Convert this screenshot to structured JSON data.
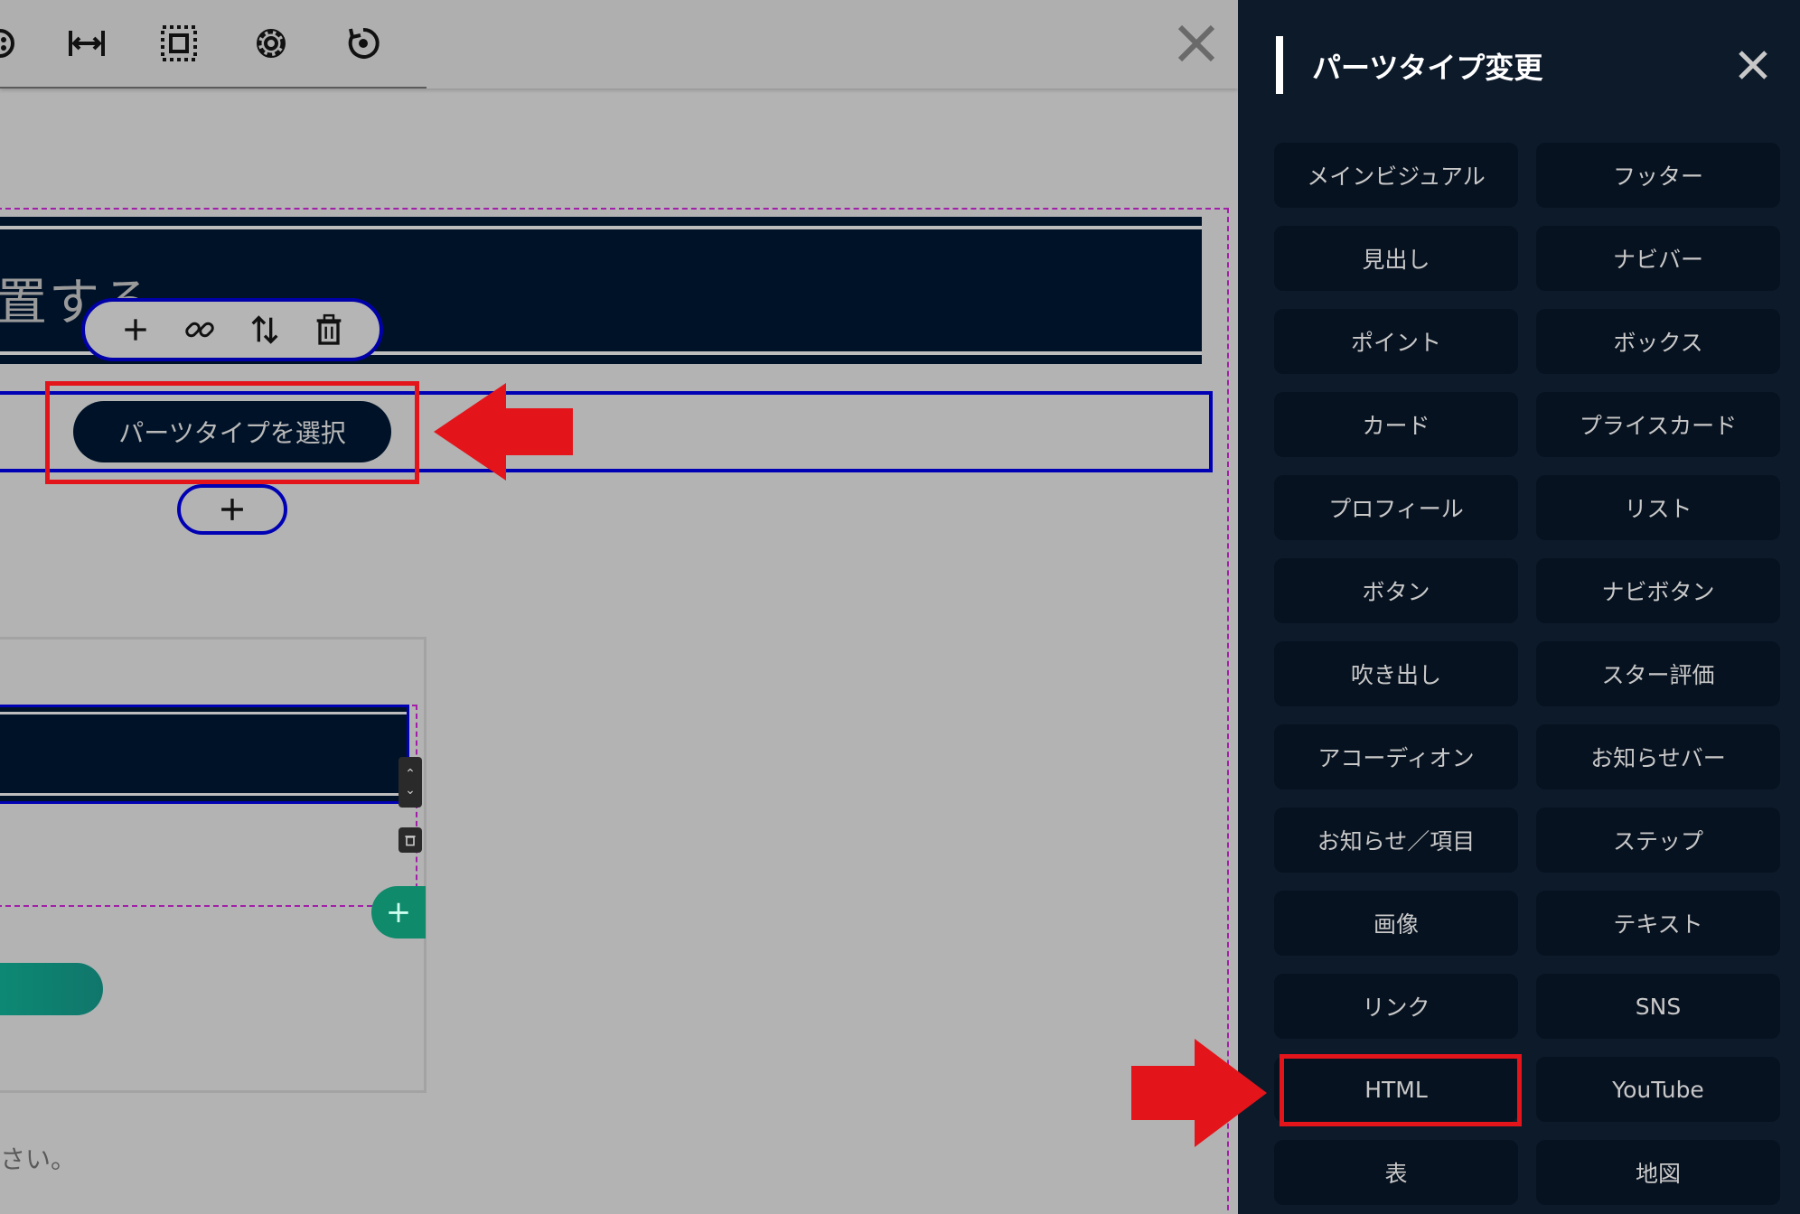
{
  "editor": {
    "heading_text": "置する",
    "select_type_label": "パーツタイプを選択",
    "footer_text": "さい。"
  },
  "panel": {
    "title": "パーツタイプ変更",
    "types": [
      "メインビジュアル",
      "フッター",
      "見出し",
      "ナビバー",
      "ポイント",
      "ボックス",
      "カード",
      "プライスカード",
      "プロフィール",
      "リスト",
      "ボタン",
      "ナビボタン",
      "吹き出し",
      "スター評価",
      "アコーディオン",
      "お知らせバー",
      "お知らせ／項目",
      "ステップ",
      "画像",
      "テキスト",
      "リンク",
      "SNS",
      "HTML",
      "YouTube",
      "表",
      "地図"
    ]
  },
  "colors": {
    "panel_bg": "#0d1a2a",
    "button_bg": "#071220",
    "highlight_red": "#e3151b",
    "select_blue": "#0000b4",
    "frame_magenta": "#a11fa8"
  }
}
